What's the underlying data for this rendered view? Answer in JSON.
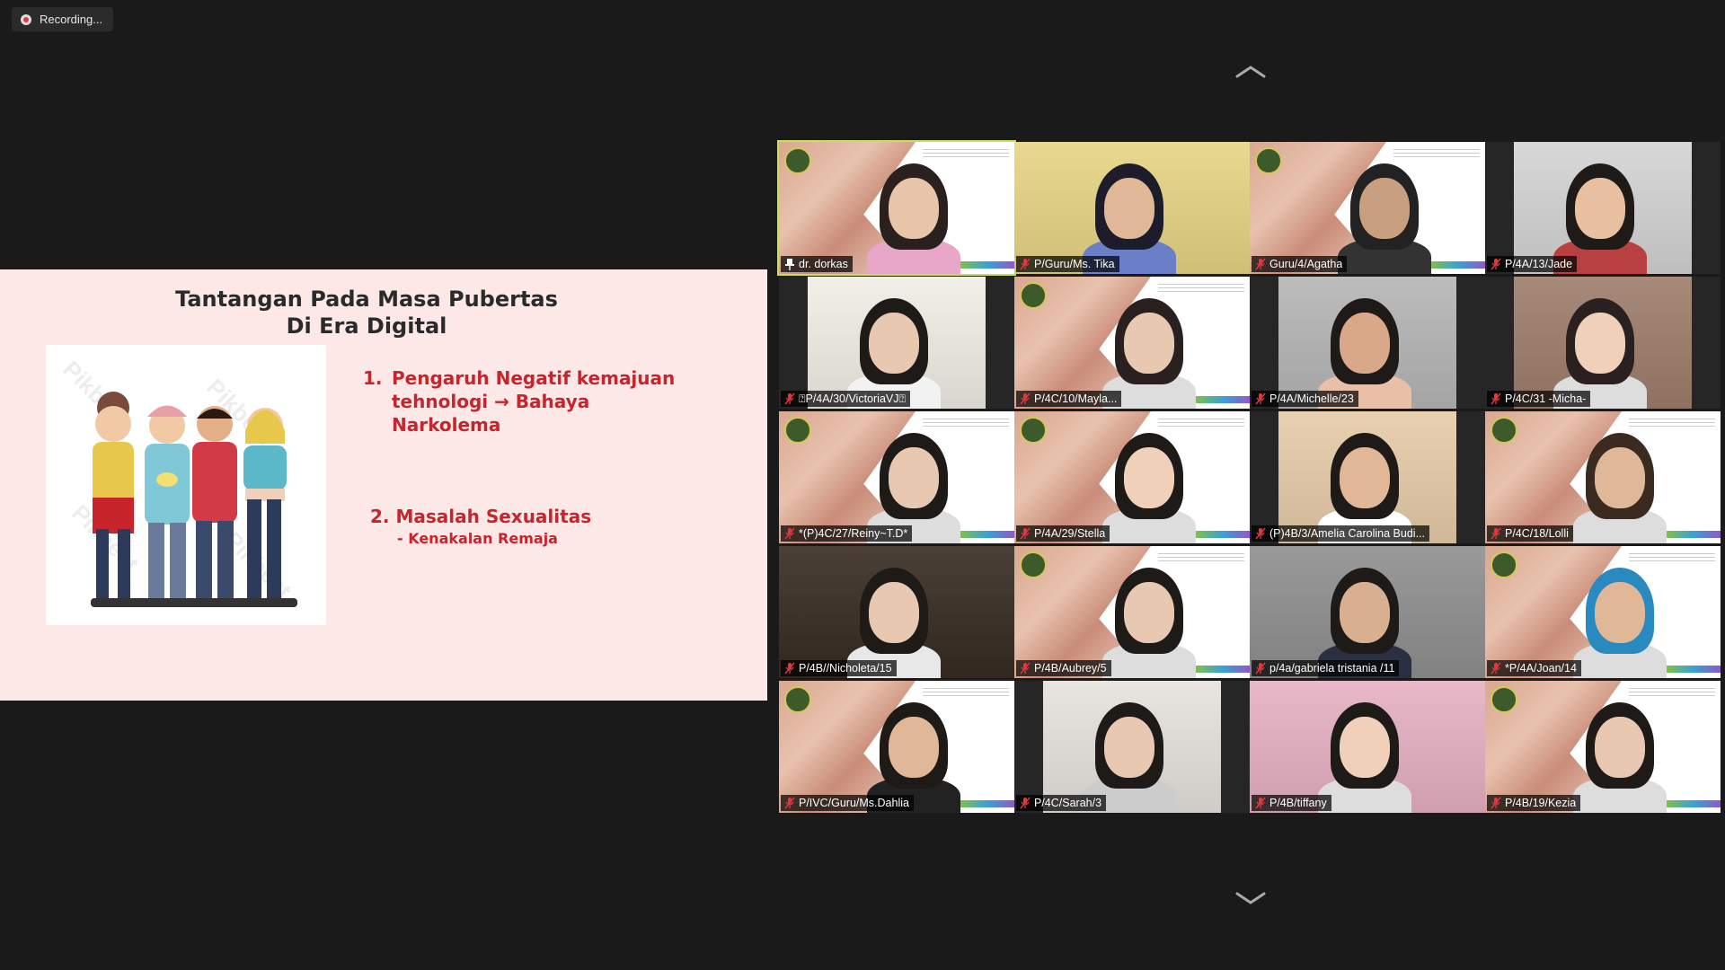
{
  "recording": {
    "label": "Recording..."
  },
  "slide": {
    "title_line1": "Tantangan Pada Masa Pubertas",
    "title_line2": "Di Era Digital",
    "point1_number": "1.",
    "point1_text": "Pengaruh Negatif kemajuan tehnologi  → Bahaya Narkolema",
    "point2_text": "2. Masalah  Sexualitas",
    "point2_sub": "- Kenakalan Remaja",
    "image_watermark": "Pikbest"
  },
  "gallery": {
    "scroll_up_icon": "chevron-up-icon",
    "scroll_down_icon": "chevron-down-icon",
    "participants": [
      {
        "name": "dr. dorkas",
        "icon": "pin-icon",
        "active": true,
        "bg": "slide",
        "skin": "#e8c4a8",
        "hair": "#2a2020",
        "shirt": "#e8a6c8"
      },
      {
        "name": "P/Guru/Ms. Tika",
        "icon": "mic-muted-icon",
        "bg": "#e8d890",
        "skin": "#e0b898",
        "hair": "#1c1c2a",
        "shirt": "#6a7fc8"
      },
      {
        "name": "Guru/4/Agatha",
        "icon": "mic-muted-icon",
        "bg": "slide",
        "skin": "#c8a080",
        "hair": "#222",
        "shirt": "#333"
      },
      {
        "name": "P/4A/13/Jade",
        "icon": "mic-muted-icon",
        "bg": "#d8d8d8",
        "skin": "#e8c0a0",
        "hair": "#1e1a18",
        "shirt": "#b84040"
      },
      {
        "name": "⍰P/4A/30/VictoriaVJ⍰",
        "icon": "mic-muted-icon",
        "bg": "#f2eee8",
        "skin": "#e8c8b0",
        "hair": "#1e1a18",
        "shirt": "#f2f2f2"
      },
      {
        "name": "P/4C/10/Mayla...",
        "icon": "mic-muted-icon",
        "bg": "slide",
        "skin": "#e8c8b0",
        "hair": "#2a2020",
        "shirt": "#ddd"
      },
      {
        "name": "P/4A/Michelle/23",
        "icon": "mic-muted-icon",
        "bg": "#bdbdbd",
        "skin": "#d8a888",
        "hair": "#1e1a18",
        "shirt": "#e8c0a8"
      },
      {
        "name": "P/4C/31 -Micha-",
        "icon": "mic-muted-icon",
        "bg": "#a88a7a",
        "skin": "#f0d0b8",
        "hair": "#2a2020",
        "shirt": "#dddddd"
      },
      {
        "name": "*(P)4C/27/Reiny~T.D*",
        "icon": "mic-muted-icon",
        "bg": "slide",
        "skin": "#e8c8b0",
        "hair": "#1e1a18",
        "shirt": "#ddd"
      },
      {
        "name": "P/4A/29/Stella",
        "icon": "mic-muted-icon",
        "bg": "slide",
        "skin": "#f0d0b8",
        "hair": "#1e1a18",
        "shirt": "#ddd"
      },
      {
        "name": "(P)4B/3/Amelia Carolina Budi...",
        "icon": "mic-muted-icon",
        "bg": "#e8d0b0",
        "skin": "#e0b898",
        "hair": "#1e1a18",
        "shirt": "#ffffff"
      },
      {
        "name": "P/4C/18/Lolli",
        "icon": "mic-muted-icon",
        "bg": "slide",
        "skin": "#e0b898",
        "hair": "#3a2a20",
        "shirt": "#ddd"
      },
      {
        "name": "P/4B//Nicholeta/15",
        "icon": "mic-muted-icon",
        "bg": "#4a4038",
        "skin": "#e8c8b0",
        "hair": "#1e1a18",
        "shirt": "#e8e8e8"
      },
      {
        "name": "P/4B/Aubrey/5",
        "icon": "mic-muted-icon",
        "bg": "slide",
        "skin": "#e8c8b0",
        "hair": "#1e1a18",
        "shirt": "#ddd"
      },
      {
        "name": "p/4a/gabriela tristania /11",
        "icon": "mic-muted-icon",
        "bg": "#9a9a9a",
        "skin": "#d8b090",
        "hair": "#1e1a18",
        "shirt": "#2a3040"
      },
      {
        "name": "*P/4A/Joan/14",
        "icon": "mic-muted-icon",
        "bg": "slide",
        "skin": "#e0b898",
        "hair": "#2a8ac0",
        "shirt": "#ddd"
      },
      {
        "name": "P/IVC/Guru/Ms.Dahlia",
        "icon": "mic-muted-icon",
        "bg": "slide",
        "skin": "#e0b898",
        "hair": "#1e1a18",
        "shirt": "#222"
      },
      {
        "name": "P/4C/Sarah/3",
        "icon": "mic-muted-icon",
        "bg": "#e8e4e0",
        "skin": "#e8c8b0",
        "hair": "#1e1a18",
        "shirt": "#ccc"
      },
      {
        "name": "P/4B/tiffany",
        "icon": "mic-muted-icon",
        "bg": "#e8b8c8",
        "skin": "#f0d0b8",
        "hair": "#1e1a18",
        "shirt": "#ddd"
      },
      {
        "name": "P/4B/19/Kezia",
        "icon": "mic-muted-icon",
        "bg": "slide",
        "skin": "#e8c8b0",
        "hair": "#1e1a18",
        "shirt": "#ddd"
      }
    ]
  },
  "colors": {
    "background": "#1a1a1a",
    "active_speaker": "#c9e05c",
    "slide_bg": "#fde8e8",
    "slide_accent": "#c7242b"
  }
}
